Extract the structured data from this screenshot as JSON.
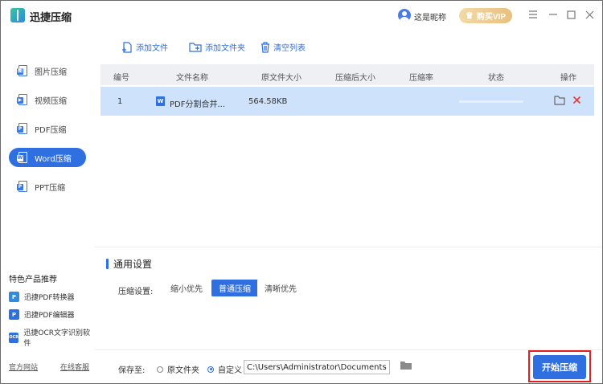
{
  "app": {
    "title": "迅捷压缩"
  },
  "header": {
    "nickname": "这是昵称",
    "vip_label": "购买VIP"
  },
  "sidebar": {
    "items": [
      {
        "label": "图片压缩",
        "badge": "图"
      },
      {
        "label": "视频压缩",
        "badge": "▶"
      },
      {
        "label": "PDF压缩",
        "badge": "P"
      },
      {
        "label": "Word压缩",
        "badge": "W"
      },
      {
        "label": "PPT压缩",
        "badge": "P"
      }
    ],
    "recommend_title": "特色产品推荐",
    "recommend": [
      {
        "label": "迅捷PDF转换器",
        "icon_text": "P",
        "color": "#2f8be0"
      },
      {
        "label": "迅捷PDF编辑器",
        "icon_text": "P",
        "color": "#2f6fe0"
      },
      {
        "label": "迅捷OCR文字识别软件",
        "icon_text": "OCR",
        "color": "#2f6fe0"
      }
    ],
    "links": {
      "official": "官方网站",
      "support": "在线客服"
    }
  },
  "toolbar": {
    "add_file": "添加文件",
    "add_folder": "添加文件夹",
    "clear_list": "清空列表"
  },
  "table": {
    "headers": [
      "编号",
      "文件名称",
      "原文件大小",
      "压缩后大小",
      "压缩率",
      "状态",
      "操作"
    ],
    "rows": [
      {
        "index": "1",
        "name": "PDF分割合并...",
        "original_size": "564.58KB",
        "compressed_size": "",
        "ratio": "",
        "status": ""
      }
    ]
  },
  "settings": {
    "title": "通用设置",
    "label": "压缩设置:",
    "options": [
      "缩小优先",
      "普通压缩",
      "清晰优先"
    ],
    "selected": "普通压缩"
  },
  "save": {
    "label": "保存至:",
    "options": [
      "原文件夹",
      "自定义"
    ],
    "selected": "自定义",
    "path": "C:\\Users\\Administrator\\Documents"
  },
  "start_button": "开始压缩",
  "colors": {
    "accent": "#2f6fe0",
    "row_selected": "#cfe2fb",
    "highlight": "#e02020",
    "vip": "#e8c07e"
  }
}
